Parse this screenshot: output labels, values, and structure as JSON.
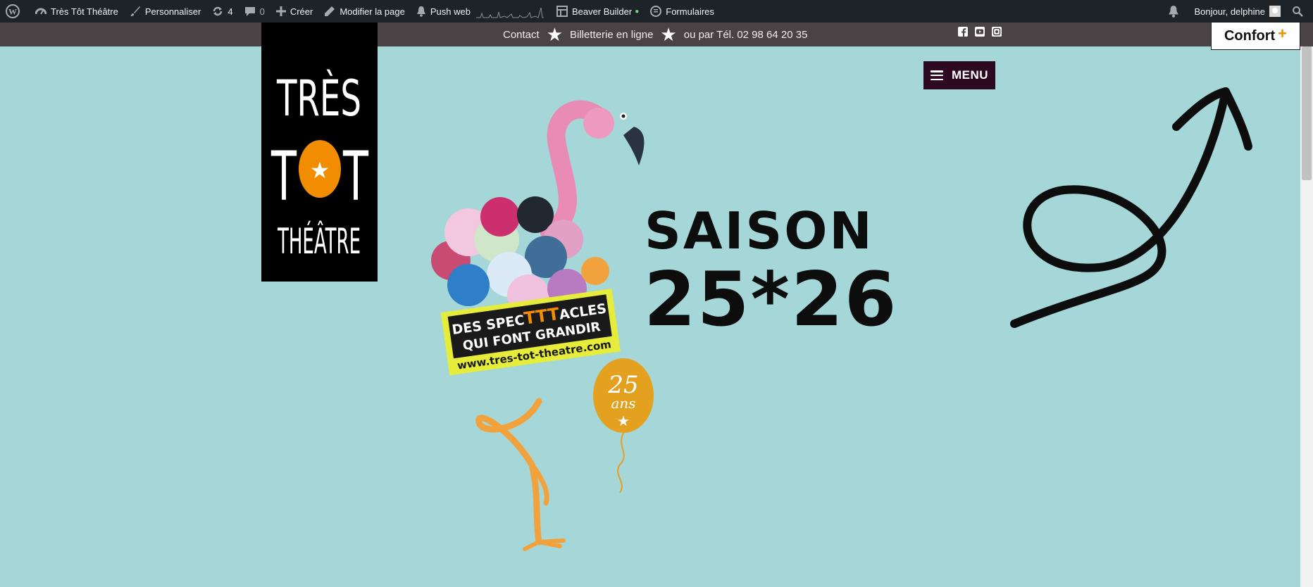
{
  "adminbar": {
    "site_name": "Très Tôt Théâtre",
    "customize": "Personnaliser",
    "updates_count": "4",
    "comments_count": "0",
    "create": "Créer",
    "edit_page": "Modifier la page",
    "push_web": "Push web",
    "beaver_builder": "Beaver Builder",
    "forms": "Formulaires",
    "greeting": "Bonjour, delphine"
  },
  "topbar": {
    "contact": "Contact",
    "ticketing": "Billetterie en ligne",
    "phone": "ou par Tél. 02 98 64 20 35"
  },
  "confort": {
    "label": "Confort",
    "plus": "+"
  },
  "logo": {
    "line1": "TRÈS",
    "line2a": "T",
    "line2b": "T",
    "line3": "THÉÂTRE"
  },
  "menu": {
    "label": "MENU"
  },
  "hero": {
    "saison": "SAISON",
    "years": "25*26",
    "sign_line1_a": "DES SPEC",
    "sign_line1_b": "TTT",
    "sign_line1_c": "ACLES",
    "sign_line2": "QUI FONT GRANDIR",
    "sign_url": "www.tres-tot-theatre.com",
    "balloon_num": "25",
    "balloon_text": "ans"
  },
  "colors": {
    "background": "#a5d6d8",
    "adminbar": "#1d2327",
    "topbar": "#4a4345",
    "menu": "#2d0a22",
    "accent_orange": "#f28c00"
  },
  "icons": [
    "wordpress-icon",
    "dashboard-icon",
    "brush-icon",
    "updates-icon",
    "comment-icon",
    "plus-icon",
    "pencil-icon",
    "bell-icon",
    "beaver-builder-icon",
    "forms-icon",
    "notification-bell-icon",
    "search-icon",
    "facebook-icon",
    "youtube-icon",
    "instagram-icon",
    "hamburger-icon"
  ]
}
